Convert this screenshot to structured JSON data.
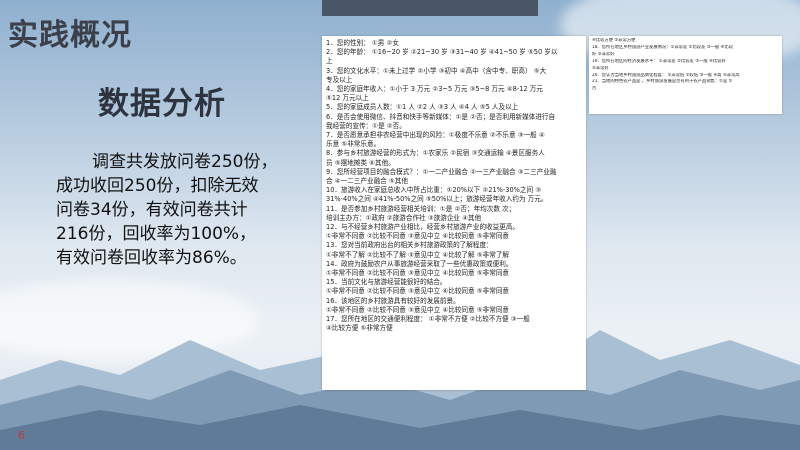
{
  "slide": {
    "title": "实践概况",
    "subtitle": "数据分析",
    "body_lines": [
      "调查共发放问卷250份，",
      "成功收回250份，扣除无效",
      "问卷34份，有效问卷共计",
      "216份，回收率为100%，",
      "有效问卷回收率为86%。"
    ],
    "page_number": "6"
  },
  "questionnaire_main": [
    "1．您的性别：  ①男      ②女",
    "2．您的年龄：  ①16~20 岁  ②21~30 岁  ③31~40 岁  ④41~50 岁  ⑤50 岁以",
    "上",
    "3．您的文化水平：①未上过学  ②小学 ③初中  ④高中（含中专、职高）  ⑤大",
    "专及以上",
    "4．您的家庭年收入：①小于 3 万元    ②3~5 万元    ③5~8 万元   ④8-12 万元",
    "⑤12 万元以上",
    "5．您的家庭成员人数：①1 人    ②2 人     ③3 人     ④4 人     ⑤5 人及以上",
    "6．是否会使用微信、抖音和快手等新媒体：①是  ②否；是否利用新媒体进行自",
    "我经营的宣传：①是    ②否。",
    "7．是否愿意承担非农经营中出现的风险：①极度不乐意    ②不乐意    ③一般    ④",
    "乐意    ⑤非常乐意。",
    "8．参与乡村旅游经营的形式为：①农家乐  ②民宿  ③交通运输  ④景区服务人",
    "员   ⑤摆地摊类   ⑥其他。",
    "9．您所经营项目的融合模式？：①一二产业融合  ②一三产业融合  ③二三产业融",
    "合    ④一二三产业融合    ⑤其他",
    "10．旅游收入在家庭总收入中所占比重：①20%以下    ②21%-30%之间    ③",
    "31%-40%之间  ④41%-50%之间   ⑤50%以上；旅游经营年收入约为    万元。",
    "11．是否参加乡村旅游经营相关培训：①是  ②否；年均次数    次；",
    "培训主办方：①政府    ②旅游合作社    ③旅游企业    ④其他",
    "12．与不经营乡村旅游产业相比，经营乡村旅游产业的收益更高。",
    "①非常不同意    ②比较不同意    ③意见中立    ④比较同意    ⑤非常同意",
    "13．您对当前政府出台的相关乡村旅游政策的了解程度：",
    "①非常不了解    ②比较不了解    ③意见中立    ④比较了解    ⑤非常了解",
    "14．政府为鼓励农户从事旅游经营采取了一些优惠政策或便利。",
    "①非常不同意    ②比较不同意    ③意见中立    ④比较同意    ⑤非常同意",
    "15．当前文化与旅游经营能很好的结合。",
    "①非常不同意    ②比较不同意    ③意见中立    ④比较同意    ⑤非常同意",
    "16．该地区的乡村旅游具有较好的发展前景。",
    "①非常不同意    ②比较不同意    ③意见中立    ④比较同意    ⑤非常同意",
    "17．您所在地区的交通便利程度：  ①非常不方便    ②比较不方便    ③一般",
    "④比较方便    ⑤非常方便"
  ],
  "questionnaire_extra": [
    "④比较方便    ⑤非常方便",
    "18．您所在地区乡村旅游产业发展情况：①非常差  ②比较差  ③一般  ④比较",
    "好  ⑤非常好",
    "19．您所在地区的经济发展水平：  ①非常差    ②比较差    ③一般    ④比较好",
    "⑤非常好",
    "20．您认为当地乡村旅游品牌化程度：  ①非常低    ②较低    ③一般    ④高    ⑤非常高",
    "21．当地的特色农产品是        ，乡村旅游发展是否有利于农产品销售：①是  ②",
    "否"
  ]
}
